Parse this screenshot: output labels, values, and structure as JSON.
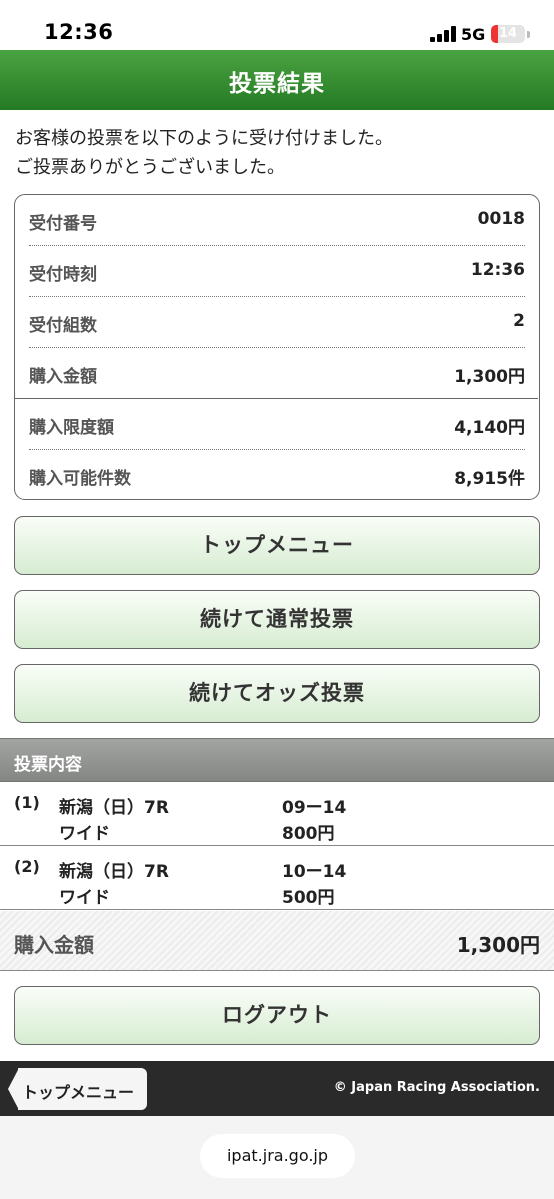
{
  "status": {
    "time": "12:36",
    "network": "5G",
    "battery": "14"
  },
  "header": {
    "title": "投票結果"
  },
  "intro": {
    "line1": "お客様の投票を以下のように受け付けました。",
    "line2": "ご投票ありがとうございました。"
  },
  "receipt": {
    "rows": [
      {
        "label": "受付番号",
        "value": "0018"
      },
      {
        "label": "受付時刻",
        "value": "12:36"
      },
      {
        "label": "受付組数",
        "value": "2"
      },
      {
        "label": "購入金額",
        "value": "1,300円"
      },
      {
        "label": "購入限度額",
        "value": "4,140円"
      },
      {
        "label": "購入可能件数",
        "value": "8,915件"
      }
    ]
  },
  "buttons": {
    "top_menu": "トップメニュー",
    "continue_normal": "続けて通常投票",
    "continue_odds": "続けてオッズ投票",
    "logout": "ログアウト"
  },
  "bets": {
    "title": "投票内容",
    "items": [
      {
        "index": "(1)",
        "race": "新潟（日）7R",
        "type": "ワイド",
        "combo": "09ー14",
        "amount": "800円"
      },
      {
        "index": "(2)",
        "race": "新潟（日）7R",
        "type": "ワイド",
        "combo": "10ー14",
        "amount": "500円"
      }
    ],
    "total_label": "購入金額",
    "total_value": "1,300円"
  },
  "footer": {
    "back_label": "トップメニュー",
    "copyright": "© Japan Racing Association."
  },
  "browser": {
    "url": "ipat.jra.go.jp"
  },
  "colors": {
    "header_green": "#257a24",
    "button_green": "#d6ecd1",
    "section_gray": "#848684",
    "footer_dark": "#2a2a2a"
  }
}
